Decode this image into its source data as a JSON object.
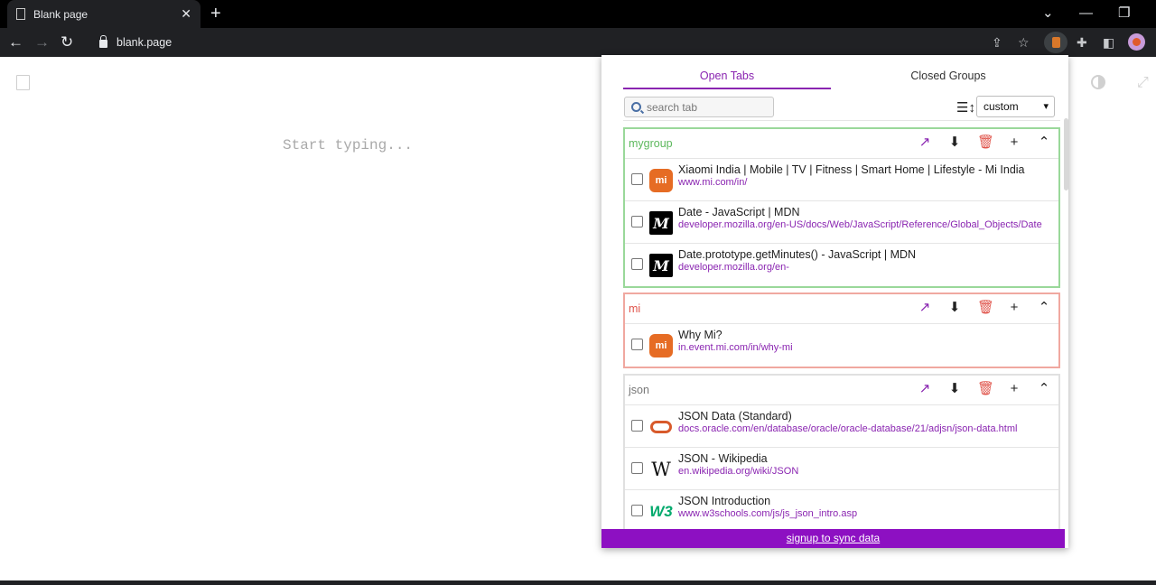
{
  "browser": {
    "tab_title": "Blank page",
    "tab_close": "✕",
    "new_tab": "+",
    "address": "blank.page",
    "win_chevron": "⌄",
    "win_minimize": "—",
    "win_restore": "❐",
    "back": "←",
    "forward": "→",
    "reload": "↻",
    "share": "⇪",
    "bookmark": "☆",
    "extensions": "✚",
    "sidepanel": "◧"
  },
  "page": {
    "placeholder": "Start typing...",
    "expand_glyph": "⤢"
  },
  "popup": {
    "tabs": {
      "open": "Open Tabs",
      "closed": "Closed Groups"
    },
    "search_placeholder": "search tab",
    "sort_icon": "☰↕",
    "sort_value": "custom",
    "sort_caret": "▾",
    "group_icons": {
      "open": "↗",
      "download": "⬇",
      "delete": "🗑",
      "add": "+",
      "collapse": "⌃"
    },
    "groups": [
      {
        "name": "mygroup",
        "color": "#9ad89a",
        "name_color": "#5cb85c",
        "items": [
          {
            "title": "Xiaomi India | Mobile | TV | Fitness | Smart Home | Lifestyle - Mi India",
            "url": "www.mi.com/in/",
            "icon": "mi-logo"
          },
          {
            "title": "Date - JavaScript | MDN",
            "url": "developer.mozilla.org/en-US/docs/Web/JavaScript/Reference/Global_Objects/Date",
            "icon": "mdn-logo"
          },
          {
            "title": "Date.prototype.getMinutes() - JavaScript | MDN",
            "url": "developer.mozilla.org/en-",
            "icon": "mdn-logo"
          }
        ]
      },
      {
        "name": "mi",
        "color": "#f0a8a0",
        "name_color": "#e0534a",
        "items": [
          {
            "title": "Why Mi?",
            "url": "in.event.mi.com/in/why-mi",
            "icon": "mi-logo"
          }
        ]
      },
      {
        "name": "json",
        "color": "#e0e0e0",
        "name_color": "#777777",
        "items": [
          {
            "title": "JSON Data (Standard)",
            "url": "docs.oracle.com/en/database/oracle/oracle-database/21/adjsn/json-data.html",
            "icon": "oracle-logo"
          },
          {
            "title": "JSON - Wikipedia",
            "url": "en.wikipedia.org/wiki/JSON",
            "icon": "wikipedia-logo"
          },
          {
            "title": "JSON Introduction",
            "url": "www.w3schools.com/js/js_json_intro.asp",
            "icon": "w3schools-logo"
          }
        ]
      }
    ],
    "signup": "signup to sync data"
  },
  "icons": {
    "mi_text": "mi",
    "mdn_text": "M",
    "wiki_text": "W",
    "w3_text": "W3"
  }
}
